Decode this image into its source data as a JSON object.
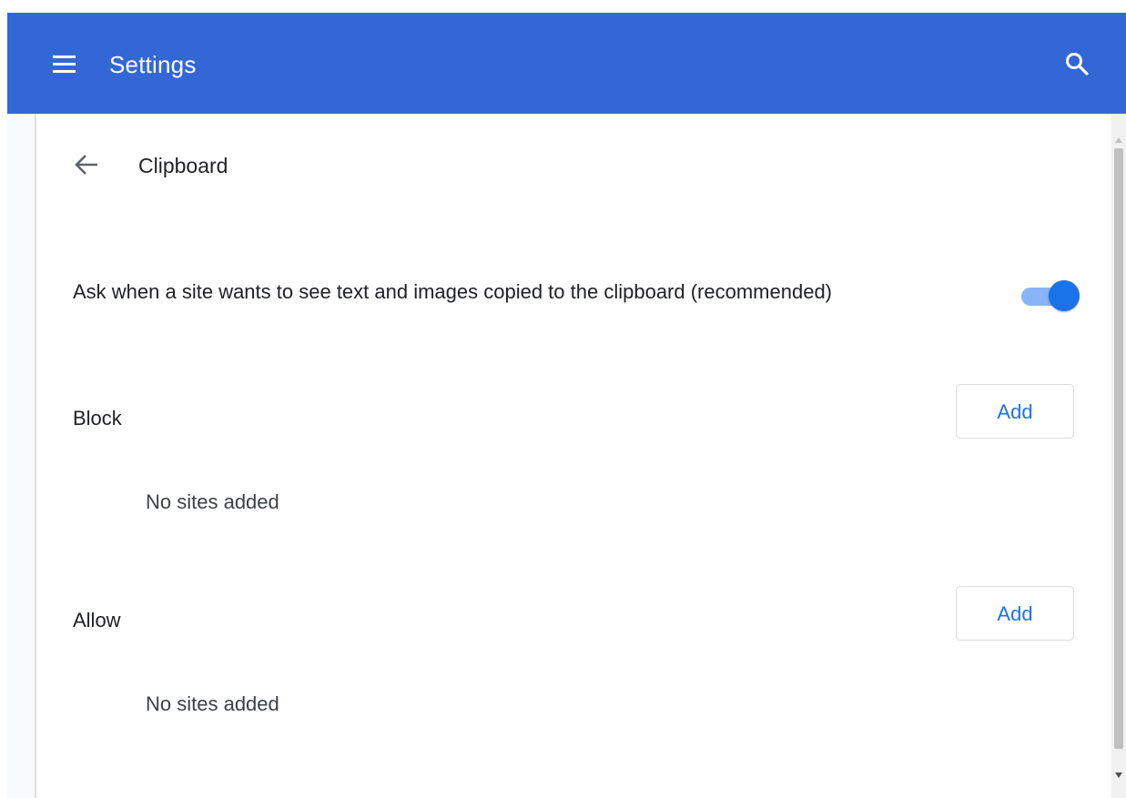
{
  "header": {
    "title": "Settings",
    "menu_icon": "hamburger-menu-icon",
    "search_icon": "search-icon",
    "background_color": "#3367d6"
  },
  "subpage": {
    "back_icon": "arrow-back-icon",
    "title": "Clipboard"
  },
  "clipboard_toggle": {
    "label": "Ask when a site wants to see text and images copied to the clipboard (recommended)",
    "checked": true,
    "accent_color": "#1a73e8"
  },
  "block_section": {
    "label": "Block",
    "add_label": "Add",
    "empty_text": "No sites added"
  },
  "allow_section": {
    "label": "Allow",
    "add_label": "Add",
    "empty_text": "No sites added"
  }
}
